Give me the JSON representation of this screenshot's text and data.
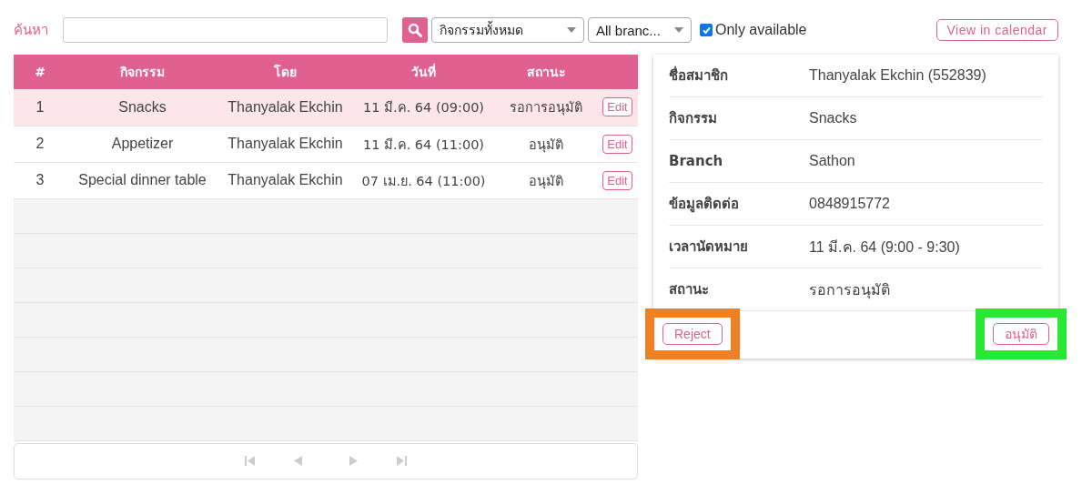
{
  "search": {
    "label": "ค้นหา"
  },
  "filters": {
    "activity": "กิจกรรมทั้งหมด",
    "branch": "All branc...",
    "only_available": {
      "label": "Only available",
      "checked": true
    }
  },
  "calendar_button": "View in calendar",
  "table": {
    "columns": [
      "#",
      "กิจกรรม",
      "โดย",
      "วันที่",
      "สถานะ"
    ],
    "rows": [
      {
        "cells": [
          "1",
          "Snacks",
          "Thanyalak Ekchin",
          "11 มี.ค. 64 (09:00)",
          "รอการอนุมัติ"
        ],
        "action": "Edit",
        "selected": true
      },
      {
        "cells": [
          "2",
          "Appetizer",
          "Thanyalak Ekchin",
          "11 มี.ค. 64 (11:00)",
          "อนุมัติ"
        ],
        "action": "Edit",
        "selected": false
      },
      {
        "cells": [
          "3",
          "Special dinner table",
          "Thanyalak Ekchin",
          "07 เม.ย. 64 (11:00)",
          "อนุมัติ"
        ],
        "action": "Edit",
        "selected": false
      }
    ]
  },
  "details": [
    {
      "label": "ชื่อสมาชิก",
      "value": "Thanyalak Ekchin (552839)"
    },
    {
      "label": "กิจกรรม",
      "value": "Snacks"
    },
    {
      "label": "Branch",
      "value": "Sathon"
    },
    {
      "label": "ข้อมูลติดต่อ",
      "value": "0848915772"
    },
    {
      "label": "เวลานัดหมาย",
      "value": "11 มี.ค. 64 (9:00 - 9:30)"
    },
    {
      "label": "สถานะ",
      "value": "รอการอนุมัติ"
    }
  ],
  "actions": [
    {
      "label": "Reject",
      "color": "#ee7f22"
    },
    {
      "label": "อนุมัติ",
      "color": "#29e832"
    }
  ]
}
